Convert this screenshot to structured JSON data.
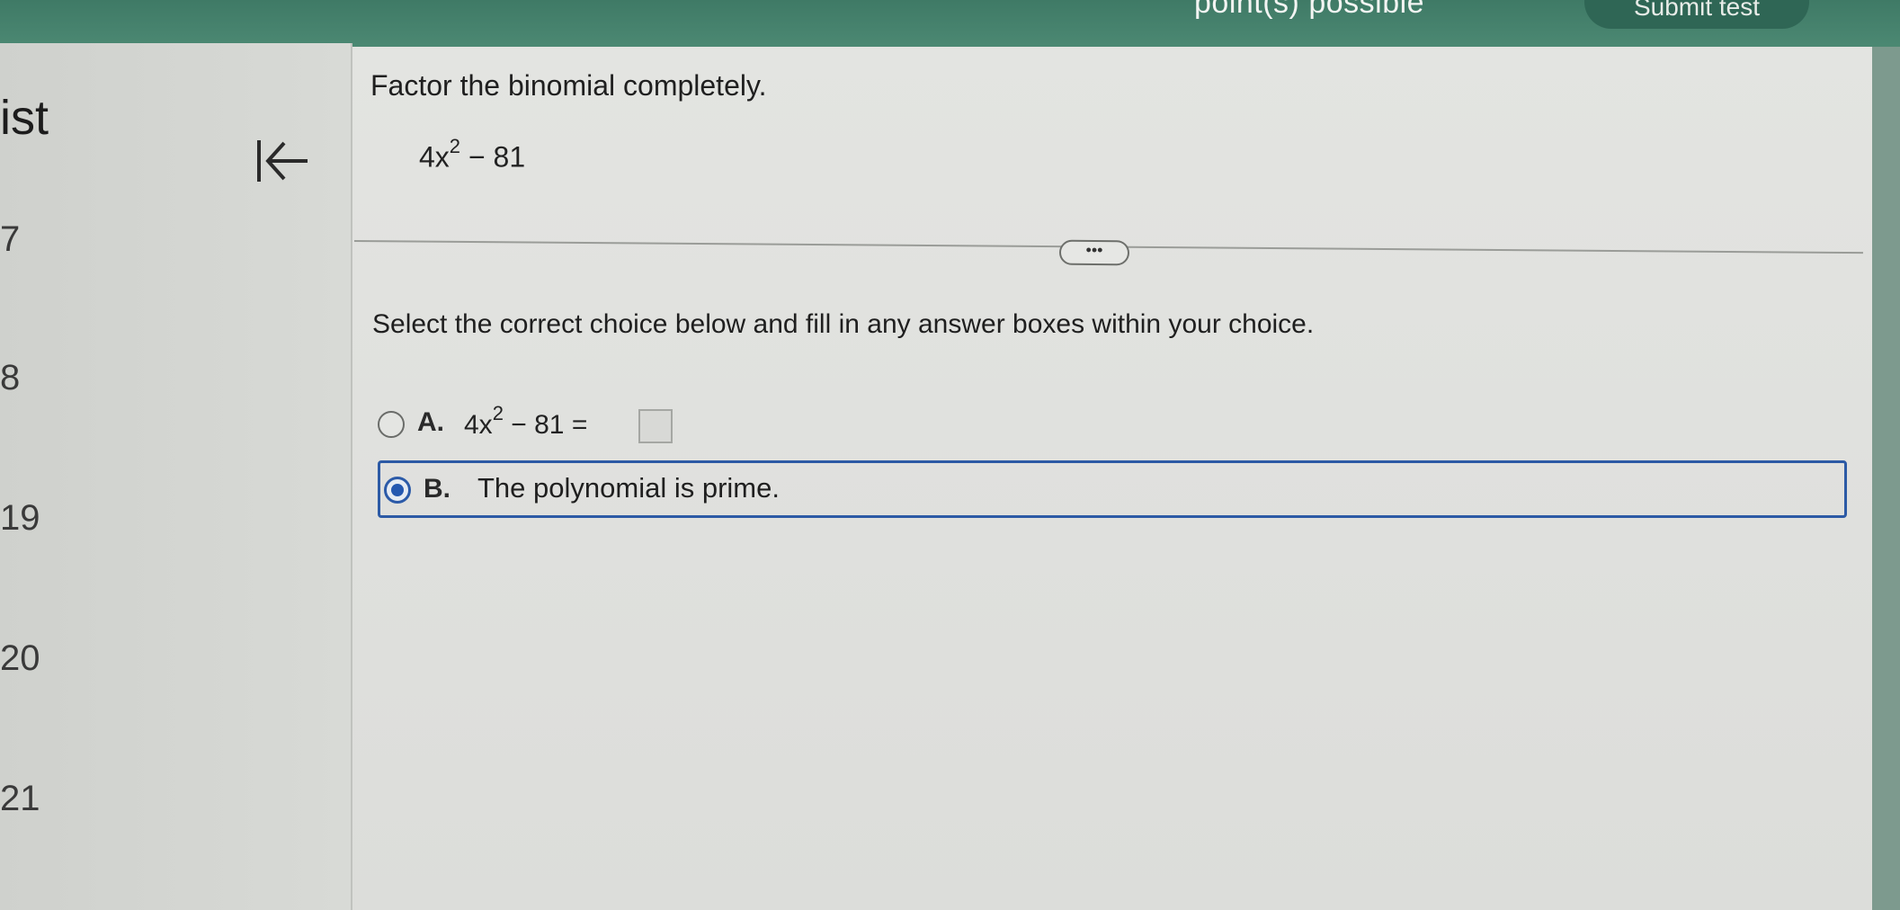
{
  "header": {
    "points_text": "point(s) possible",
    "submit_button_label": "Submit test"
  },
  "sidebar": {
    "title": "ist",
    "question_numbers": [
      "7",
      "8",
      "19",
      "20",
      "21"
    ]
  },
  "question": {
    "prompt": "Factor the binomial completely.",
    "expression_base": "4x",
    "expression_exponent": "2",
    "expression_rest": " − 81",
    "instruction": "Select the correct choice below and fill in any answer boxes within your choice."
  },
  "options": [
    {
      "letter": "A.",
      "math_base": "4x",
      "math_exponent": "2",
      "math_rest": " − 81 =",
      "selected": false
    },
    {
      "letter": "B.",
      "text": "The polynomial is prime.",
      "selected": true
    }
  ],
  "colors": {
    "header_green": "#4d8a74",
    "selection_blue": "#2c5aa5"
  }
}
